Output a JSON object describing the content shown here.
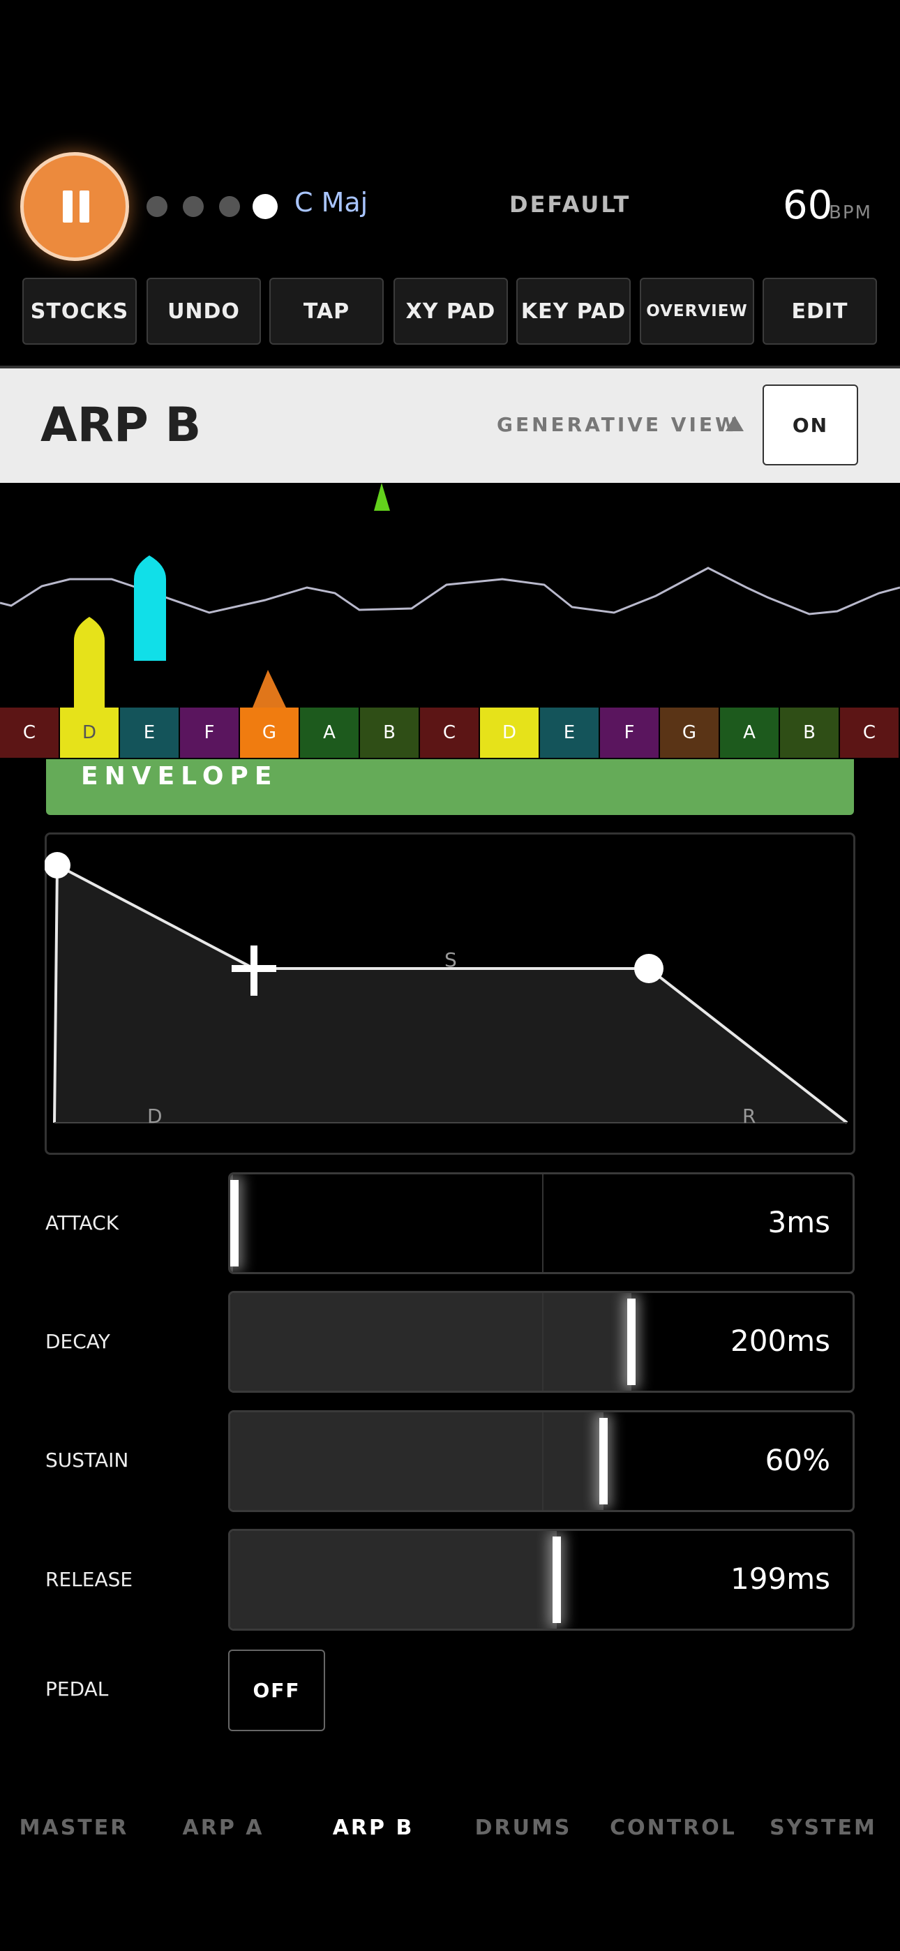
{
  "header": {
    "key_label": "C Maj",
    "preset_label": "DEFAULT",
    "bpm_value": "60",
    "bpm_unit": "BPM",
    "page_dots": 4,
    "active_dot": 4
  },
  "toolbar": [
    {
      "label": "STOCKS"
    },
    {
      "label": "UNDO"
    },
    {
      "label": "TAP"
    },
    {
      "label": "XY PAD"
    },
    {
      "label": "KEY PAD"
    },
    {
      "label": "OVERVIEW"
    },
    {
      "label": "EDIT"
    }
  ],
  "panel": {
    "title": "ARP B",
    "generative_view_label": "GENERATIVE VIEW",
    "on_label": "ON"
  },
  "keyboard": [
    {
      "note": "C",
      "color": "#5c1515"
    },
    {
      "note": "D",
      "color": "#e6e21a",
      "text_color": "#555"
    },
    {
      "note": "E",
      "color": "#14545a"
    },
    {
      "note": "F",
      "color": "#5a155e"
    },
    {
      "note": "G",
      "color": "#f07c10"
    },
    {
      "note": "A",
      "color": "#1d5a1d"
    },
    {
      "note": "B",
      "color": "#2f4e16"
    },
    {
      "note": "C",
      "color": "#5c1515"
    },
    {
      "note": "D",
      "color": "#e6e21a"
    },
    {
      "note": "E",
      "color": "#14545a"
    },
    {
      "note": "F",
      "color": "#5a155e"
    },
    {
      "note": "G",
      "color": "#5a3416"
    },
    {
      "note": "A",
      "color": "#1d5a1d"
    },
    {
      "note": "B",
      "color": "#2f4e16"
    },
    {
      "note": "C",
      "color": "#5c1515"
    }
  ],
  "envelope": {
    "title": "ENVELOPE",
    "graph_labels": {
      "decay": "D",
      "sustain": "S",
      "release": "R"
    },
    "params": [
      {
        "label": "ATTACK",
        "value": "3ms",
        "position": 0.005
      },
      {
        "label": "DECAY",
        "value": "200ms",
        "position": 0.645
      },
      {
        "label": "SUSTAIN",
        "value": "60%",
        "position": 0.6
      },
      {
        "label": "RELEASE",
        "value": "199ms",
        "position": 0.525
      }
    ],
    "pedal": {
      "label": "PEDAL",
      "value": "OFF"
    }
  },
  "tabs": [
    {
      "label": "MASTER"
    },
    {
      "label": "ARP A"
    },
    {
      "label": "ARP B",
      "active": true
    },
    {
      "label": "DRUMS"
    },
    {
      "label": "CONTROL"
    },
    {
      "label": "SYSTEM"
    }
  ]
}
